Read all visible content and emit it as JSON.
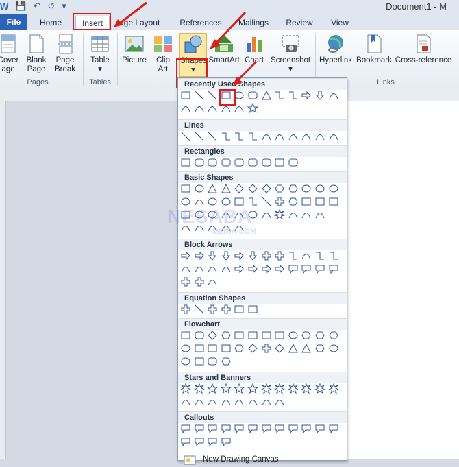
{
  "window": {
    "title": "Document1 - M"
  },
  "tabs": [
    "File",
    "Home",
    "Insert",
    "Page Layout",
    "References",
    "Mailings",
    "Review",
    "View"
  ],
  "tab_labels": {
    "file": "File",
    "home": "Home",
    "insert": "Insert",
    "page_layout": "ge Layout",
    "references": "References",
    "mailings": "Mailings",
    "review": "Review",
    "view": "View"
  },
  "ribbon": {
    "cover_page": "Cover\nPage",
    "cover_l1": "Cover",
    "cover_l2": "age",
    "blank_l1": "Blank",
    "blank_l2": "Page",
    "break_l1": "Page",
    "break_l2": "Break",
    "table": "Table",
    "picture": "Picture",
    "clip_l1": "Clip",
    "clip_l2": "Art",
    "shapes": "Shapes",
    "smartart": "SmartArt",
    "chart": "Chart",
    "screenshot": "Screenshot",
    "hyperlink": "Hyperlink",
    "bookmark": "Bookmark",
    "crossref": "Cross-reference",
    "group_pages": "Pages",
    "group_tables": "Tables",
    "group_links": "Links"
  },
  "menu": {
    "recent": "Recently Used Shapes",
    "lines": "Lines",
    "rectangles": "Rectangles",
    "basic": "Basic Shapes",
    "block_arrows": "Block Arrows",
    "equation": "Equation Shapes",
    "flowchart": "Flowchart",
    "stars": "Stars and Banners",
    "callouts": "Callouts",
    "new_canvas": "New Drawing Canvas"
  },
  "watermark": {
    "main": "NESABA",
    "sub": "MEDIA.COM"
  },
  "colors": {
    "highlight": "#e01b1b",
    "file_tab": "#2a63b9",
    "shape_stroke": "#2f5597"
  }
}
